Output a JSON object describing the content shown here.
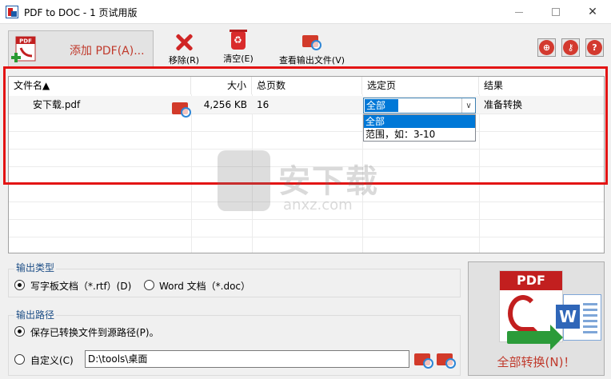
{
  "window": {
    "title": "PDF to DOC - 1 页试用版"
  },
  "toolbar": {
    "add_pdf": "添加 PDF(A)...",
    "remove": "移除(R)",
    "clear": "清空(E)",
    "view_output": "查看输出文件(V)"
  },
  "table": {
    "headers": {
      "filename": "文件名▲",
      "size": "大小",
      "pages": "总页数",
      "selected_pages": "选定页",
      "result": "结果"
    },
    "rows": [
      {
        "filename": "安下载.pdf",
        "size": "4,256 KB",
        "pages": "16",
        "selected_pages": "全部",
        "result": "准备转换"
      }
    ],
    "page_options": [
      "全部",
      "范围，如：3-10"
    ]
  },
  "watermark": {
    "text": "安下载",
    "subtext": "anxz.com"
  },
  "output_type": {
    "legend": "输出类型",
    "option_rtf": "写字板文档（*.rtf）(D)",
    "option_doc": "Word 文档（*.doc）",
    "selected": "rtf"
  },
  "output_path": {
    "legend": "输出路径",
    "option_source": "保存已转换文件到源路径(P)。",
    "option_custom": "自定义(C)",
    "custom_path": "D:\\tools\\桌面",
    "selected": "source"
  },
  "convert": {
    "label": "全部转换(N)！"
  },
  "colors": {
    "accent_red": "#c0392b",
    "highlight_red": "#e31414",
    "selection_blue": "#0078d7"
  }
}
